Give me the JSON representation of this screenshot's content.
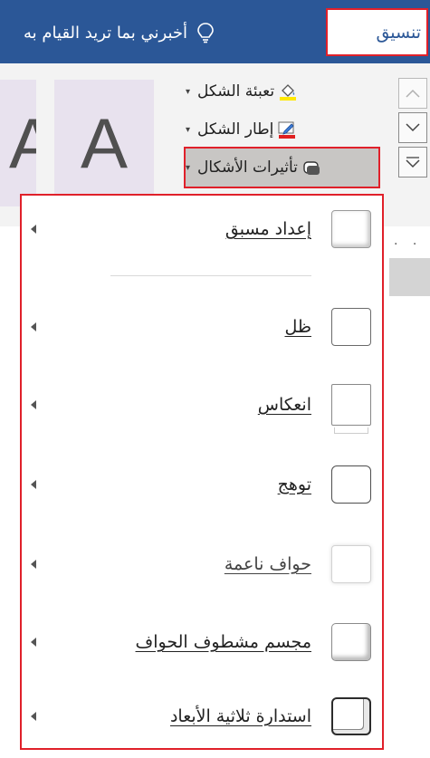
{
  "ribbon": {
    "format_tab_label": "تنسيق",
    "tell_me_label": "أخبرني بما تريد القيام به",
    "gallery_letter": "A",
    "shape_fill_label": "تعبئة الشكل",
    "shape_outline_label": "إطار الشكل",
    "shape_effects_label": "تأثيرات الأشكال",
    "caret": "▾",
    "dots": "· ·"
  },
  "menu": {
    "items": [
      {
        "label": "إعداد مسبق",
        "name": "preset"
      },
      {
        "label": "ظل",
        "name": "shadow"
      },
      {
        "label": "انعكاس",
        "name": "reflection"
      },
      {
        "label": "توهج",
        "name": "glow"
      },
      {
        "label": "حواف ناعمة",
        "name": "soft-edges"
      },
      {
        "label": "مجسم مشطوف الحواف",
        "name": "bevel"
      },
      {
        "label": "استدارة ثلاثية الأبعاد",
        "name": "3d-rotation"
      }
    ]
  },
  "colors": {
    "ribbon_blue": "#2b5797",
    "highlight_red": "#e0202a",
    "fill_yellow": "#ffe800",
    "outline_red": "#e02020"
  },
  "icons": {
    "lightbulb": "lightbulb-icon",
    "paint_bucket": "paint-bucket-icon",
    "pencil": "pencil-icon",
    "effects": "shape-effects-icon"
  }
}
